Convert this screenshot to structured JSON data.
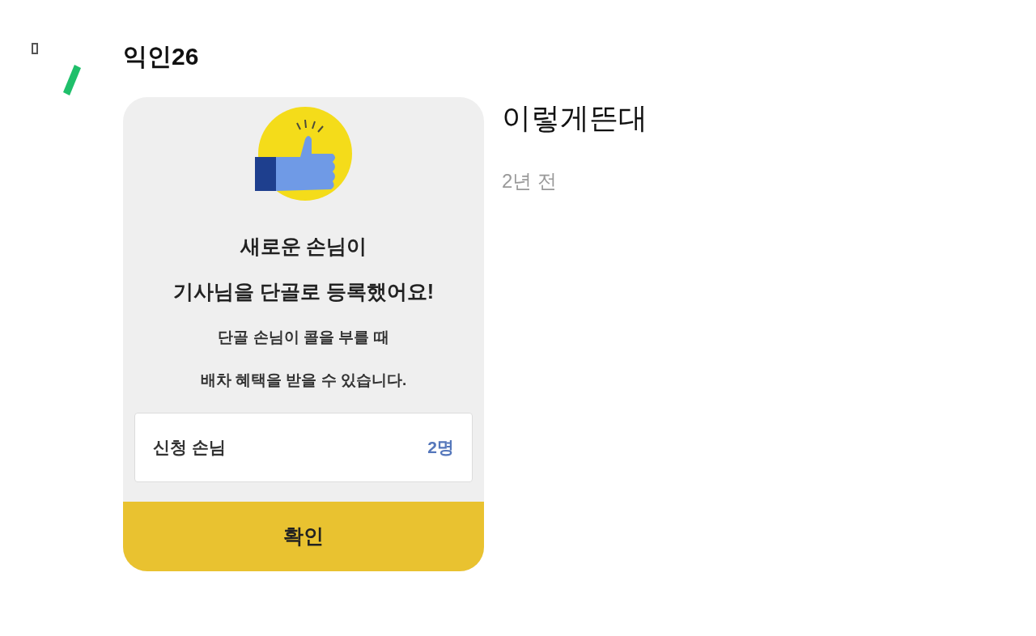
{
  "comment": {
    "author": "익인26",
    "text": "이렇게뜬대",
    "time": "2년 전"
  },
  "dialog": {
    "title_lines": [
      "새로운 손님이",
      "기사님을 단골로 등록했어요!"
    ],
    "body_lines": [
      "단골 손님이 콜을 부를 때",
      "배차 혜택을 받을 수 있습니다."
    ],
    "info_row": {
      "label": "신청 손님",
      "value": "2명"
    },
    "button": "확인"
  }
}
